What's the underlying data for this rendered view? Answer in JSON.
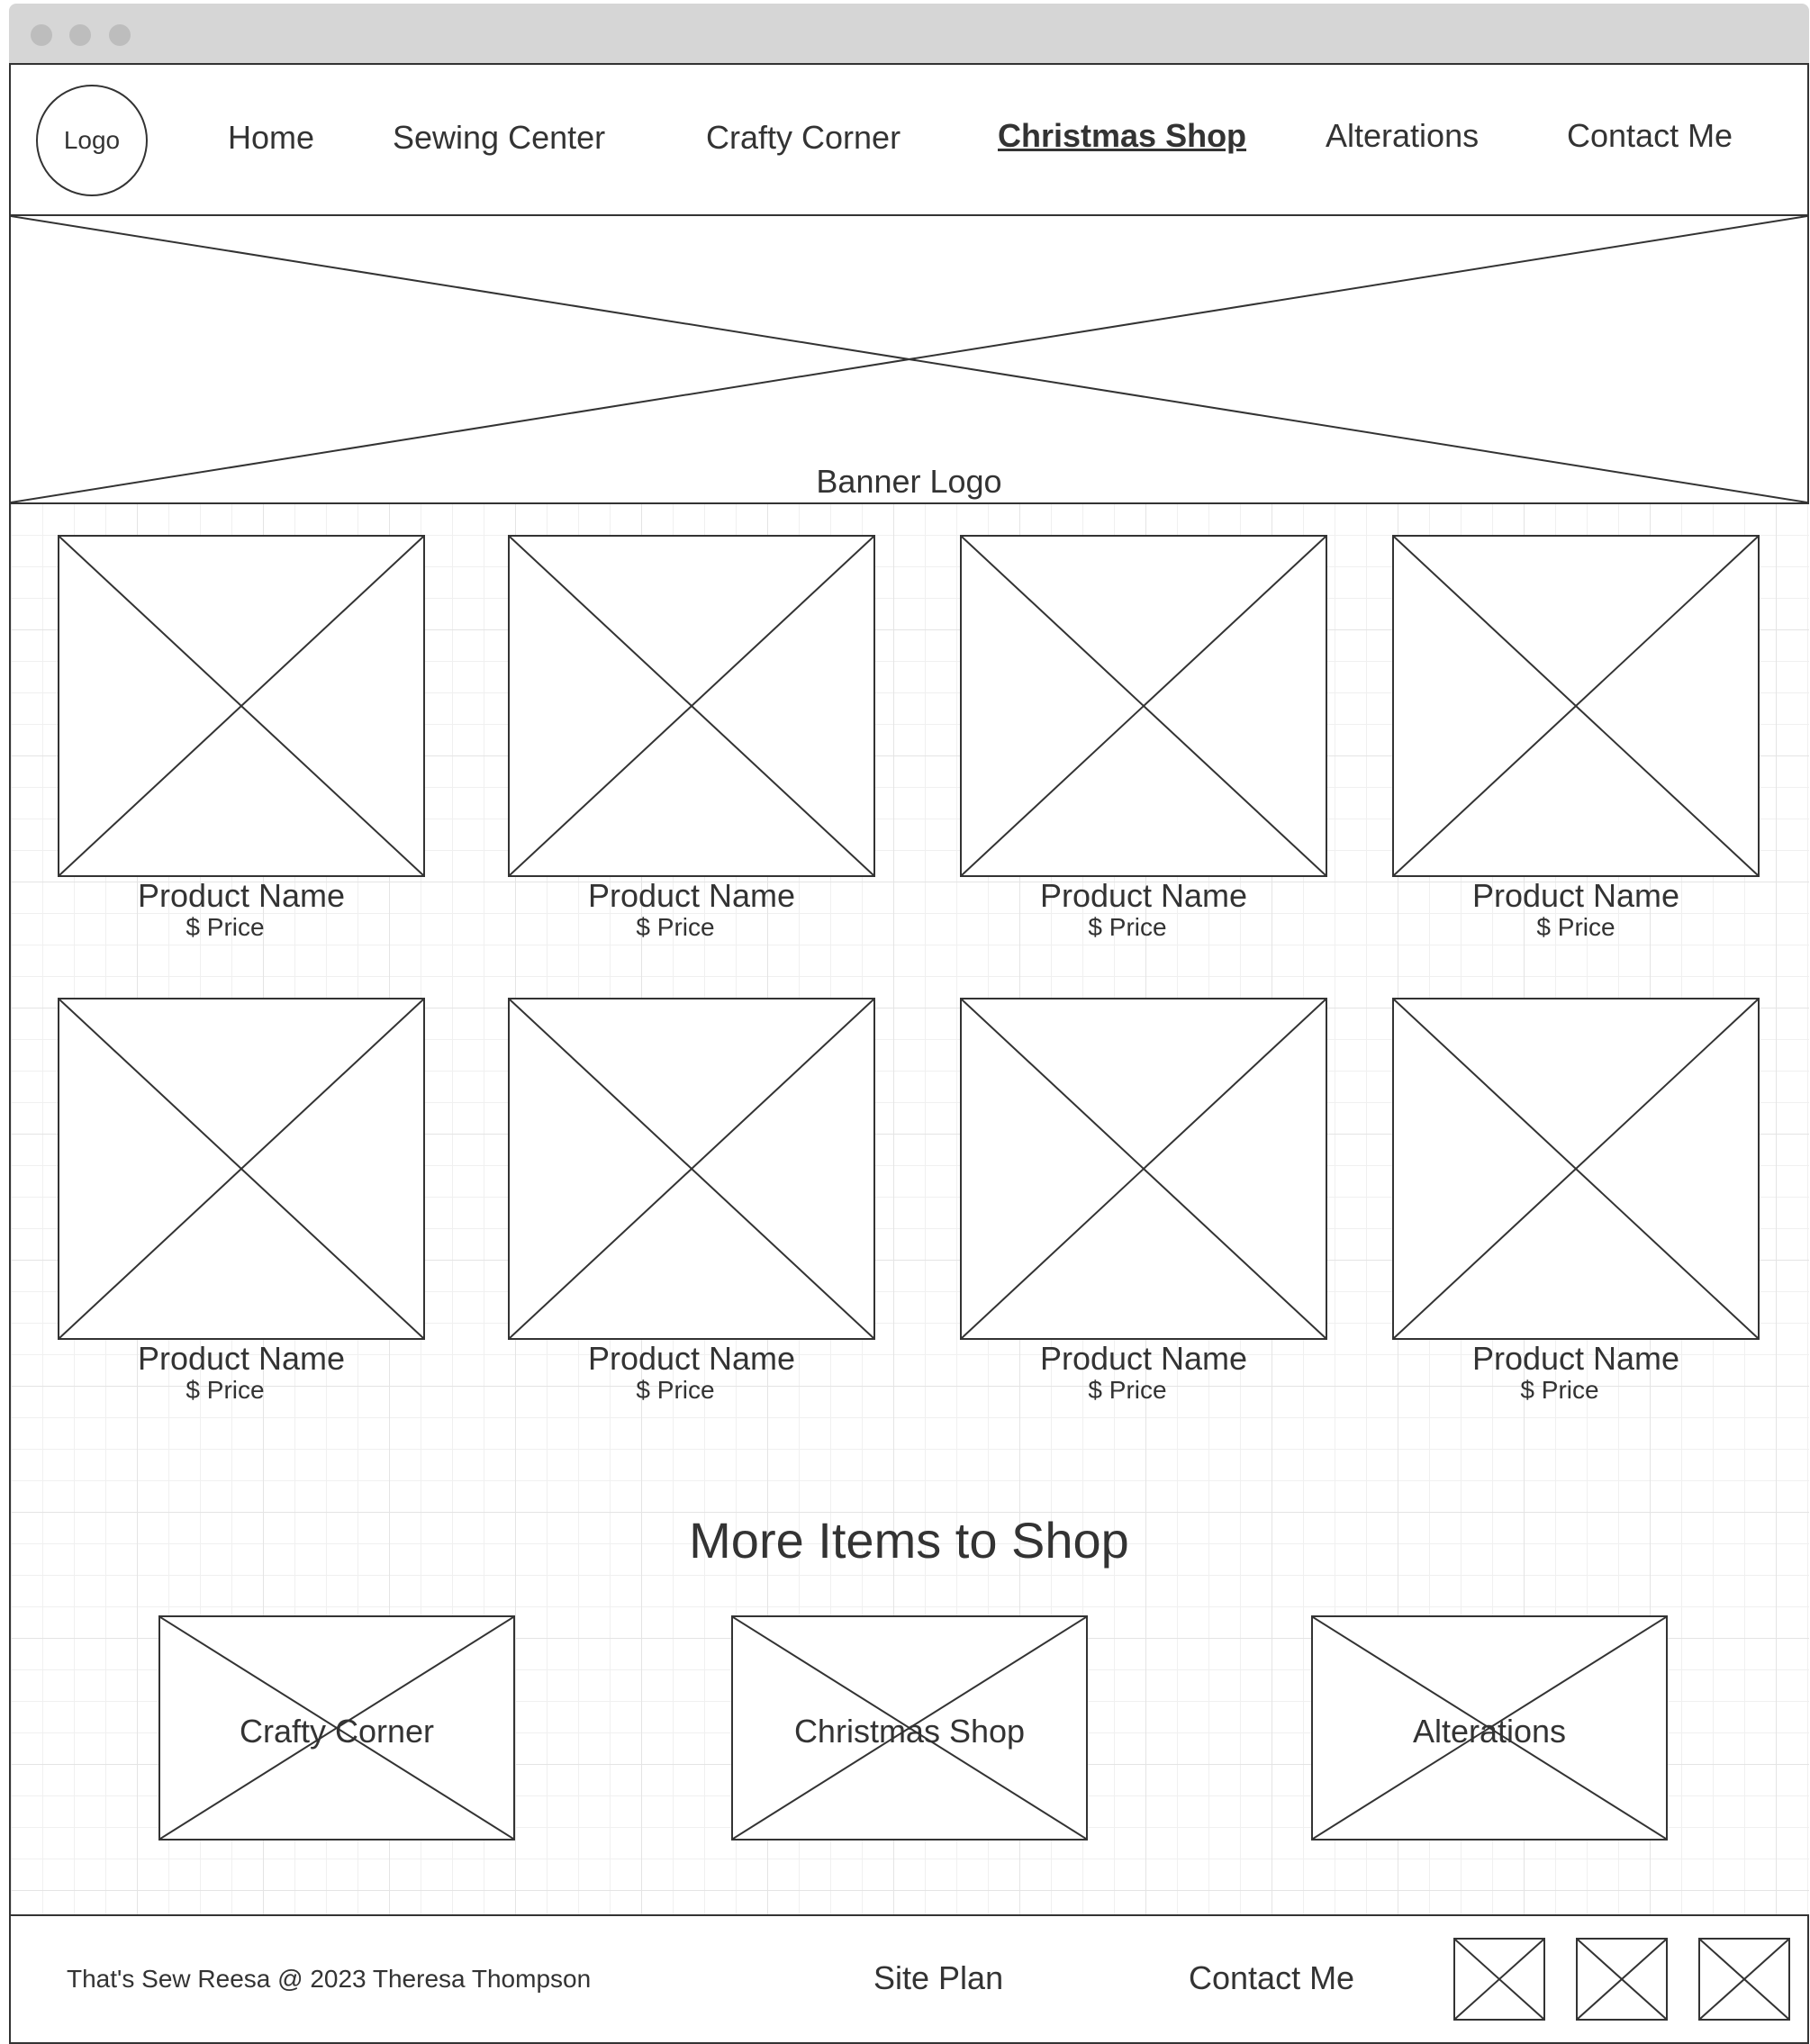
{
  "header": {
    "logo_label": "Logo",
    "nav": [
      {
        "label": "Home",
        "active": false
      },
      {
        "label": "Sewing Center",
        "active": false
      },
      {
        "label": "Crafty Corner",
        "active": false
      },
      {
        "label": "Christmas Shop",
        "active": true
      },
      {
        "label": "Alterations",
        "active": false
      },
      {
        "label": "Contact Me",
        "active": false
      }
    ]
  },
  "banner": {
    "label": "Banner Logo"
  },
  "products": [
    {
      "name": "Product Name",
      "price": "$ Price"
    },
    {
      "name": "Product Name",
      "price": "$ Price"
    },
    {
      "name": "Product Name",
      "price": "$ Price"
    },
    {
      "name": "Product Name",
      "price": "$ Price"
    },
    {
      "name": "Product Name",
      "price": "$ Price"
    },
    {
      "name": "Product Name",
      "price": "$ Price"
    },
    {
      "name": "Product Name",
      "price": "$ Price"
    },
    {
      "name": "Product Name",
      "price": "$ Price"
    }
  ],
  "more_items": {
    "title": "More Items to Shop",
    "categories": [
      {
        "label": "Crafty Corner"
      },
      {
        "label": "Christmas Shop"
      },
      {
        "label": "Alterations"
      }
    ]
  },
  "footer": {
    "copyright": "That's Sew Reesa @ 2023 Theresa Thompson",
    "site_plan": "Site Plan",
    "contact": "Contact Me"
  }
}
